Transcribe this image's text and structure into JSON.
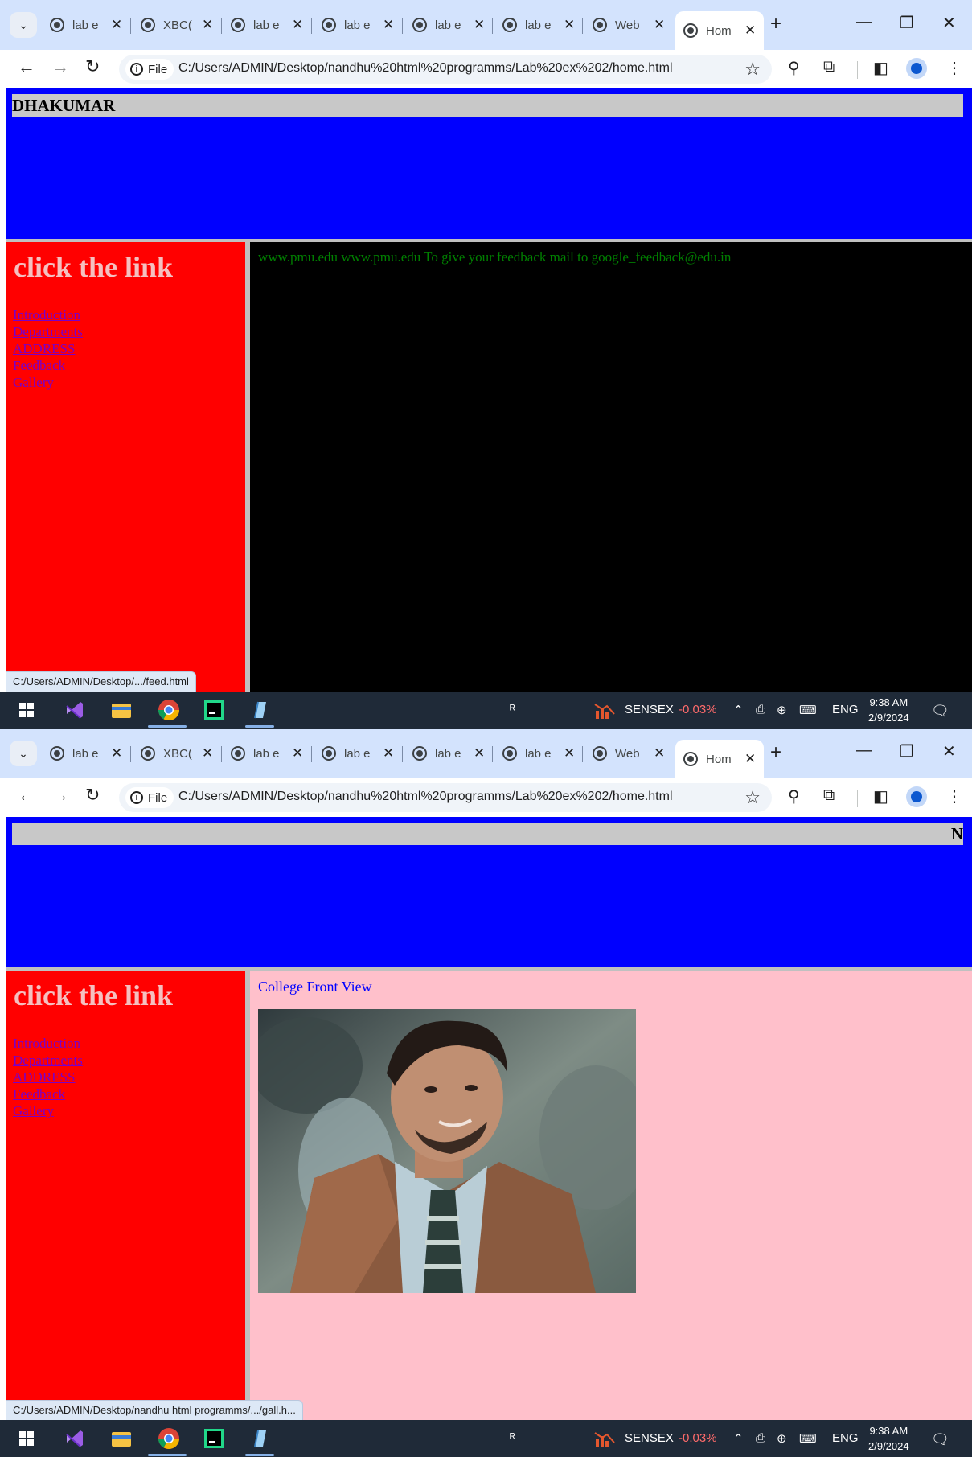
{
  "browser": {
    "tabs": [
      {
        "label": "lab e"
      },
      {
        "label": "XBC("
      },
      {
        "label": "lab e"
      },
      {
        "label": "lab e"
      },
      {
        "label": "lab e"
      },
      {
        "label": "lab e"
      },
      {
        "label": "Web"
      },
      {
        "label": "Hom"
      }
    ],
    "file_chip": "File",
    "url": "C:/Users/ADMIN/Desktop/nandhu%20html%20programms/Lab%20ex%202/home.html"
  },
  "page": {
    "marquee_text_1": "DHAKUMAR",
    "marquee_text_2": "N",
    "sidebar_title": "click the link",
    "links": [
      {
        "label": "Introduction"
      },
      {
        "label": "Departments"
      },
      {
        "label": "ADDRESS"
      },
      {
        "label": "Feedback"
      },
      {
        "label": "Gallery"
      }
    ],
    "feedback_text": "www.pmu.edu www.pmu.edu To give your feedback mail to google_feedback@edu.in",
    "gallery_caption": "College Front View"
  },
  "status": {
    "link_1": "C:/Users/ADMIN/Desktop/.../feed.html",
    "link_2": "C:/Users/ADMIN/Desktop/nandhu html programms/.../gall.h..."
  },
  "taskbar": {
    "stock_name": "SENSEX",
    "stock_change": "-0.03%",
    "language": "ENG",
    "time": "9:38 AM",
    "date": "2/9/2024"
  },
  "colors": {
    "header": "#0000ff",
    "sidebar": "#ff0000",
    "feedback_bg": "#000000",
    "gallery_bg": "#ffc0cb"
  }
}
